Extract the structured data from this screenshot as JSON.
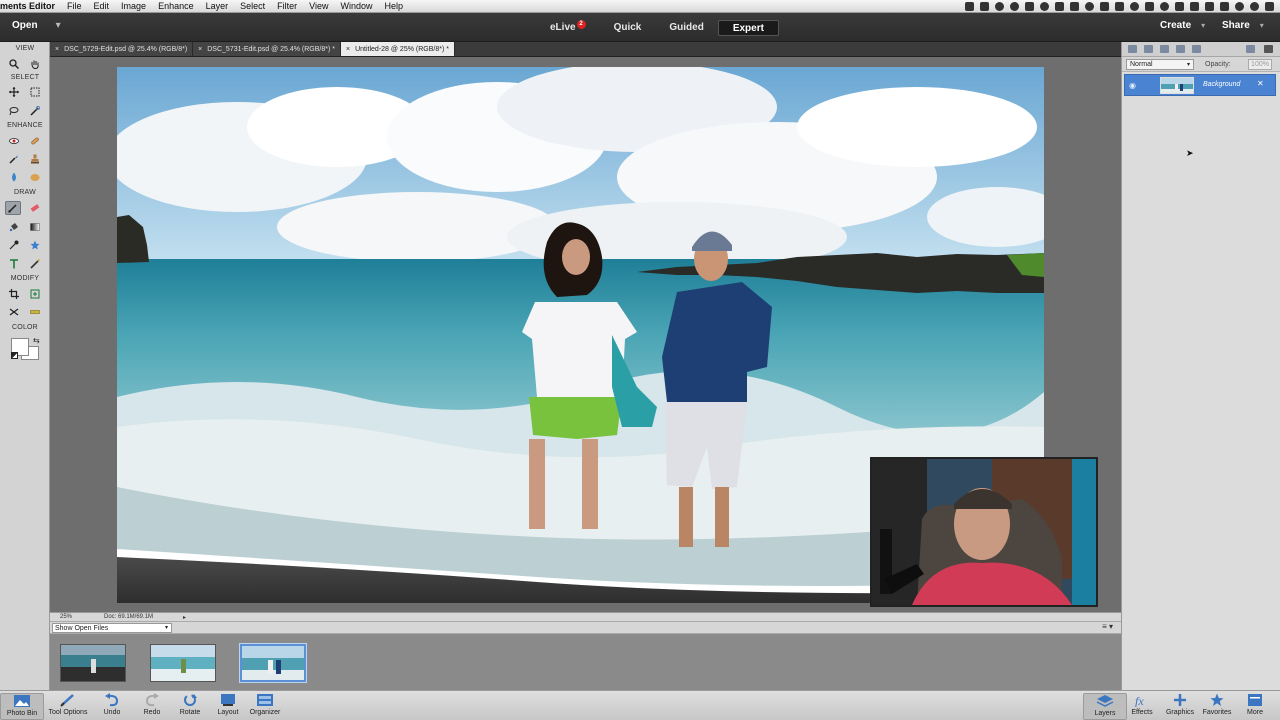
{
  "menubar": {
    "app_name": "ments Editor",
    "items": [
      "File",
      "Edit",
      "Image",
      "Enhance",
      "Layer",
      "Select",
      "Filter",
      "View",
      "Window",
      "Help"
    ]
  },
  "appbar": {
    "open_label": "Open",
    "modes": [
      {
        "label": "eLive",
        "badge": "2"
      },
      {
        "label": "Quick"
      },
      {
        "label": "Guided"
      },
      {
        "label": "Expert"
      }
    ],
    "active_mode": "Expert",
    "create_label": "Create",
    "share_label": "Share"
  },
  "toolbox": {
    "sections": [
      "VIEW",
      "SELECT",
      "ENHANCE",
      "DRAW",
      "MODIFY",
      "COLOR"
    ]
  },
  "doc_tabs": [
    {
      "label": "DSC_5729-Edit.psd @ 25.4% (RGB/8*)"
    },
    {
      "label": "DSC_5731-Edit.psd @ 25.4% (RGB/8*) *"
    },
    {
      "label": "Untitled-28 @ 25% (RGB/8*) *"
    }
  ],
  "status": {
    "zoom": "25%",
    "doc_size": "Doc: 69.1M/69.1M"
  },
  "photo_bin": {
    "show_label": "Show Open Files"
  },
  "layers_panel": {
    "blend_mode": "Normal",
    "opacity_label": "Opacity:",
    "opacity_value": "100%",
    "layers": [
      {
        "name": "Background"
      }
    ]
  },
  "taskbar": {
    "left": [
      "Photo Bin",
      "Tool Options",
      "Undo",
      "Redo",
      "Rotate",
      "Layout",
      "Organizer"
    ],
    "right": [
      "Layers",
      "Effects",
      "Graphics",
      "Favorites",
      "More"
    ]
  },
  "colors": {
    "accent": "#4a83d1",
    "toolbox_bg": "#d3d3d3",
    "canvas_bg": "#6e6e6e"
  }
}
